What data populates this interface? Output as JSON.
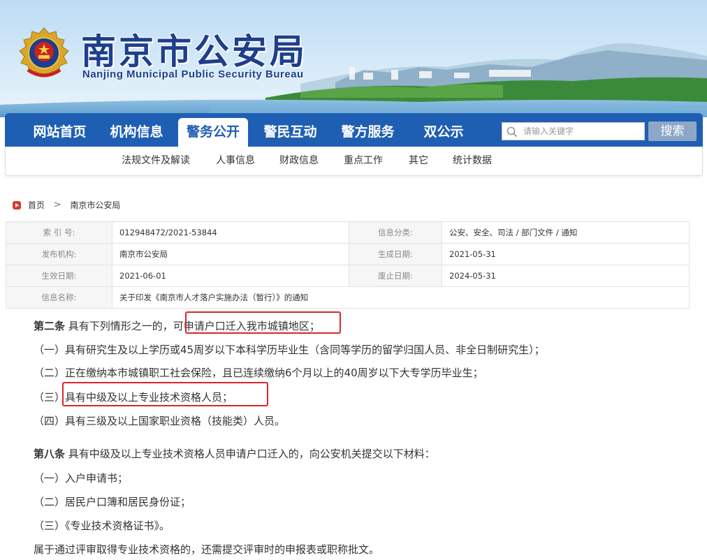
{
  "header": {
    "title": "南京市公安局",
    "subtitle": "Nanjing Municipal Public Security Bureau",
    "emblem_icon": "police-emblem-icon"
  },
  "main_nav": {
    "items": [
      {
        "label": "网站首页",
        "active": false
      },
      {
        "label": "机构信息",
        "active": false
      },
      {
        "label": "警务公开",
        "active": true
      },
      {
        "label": "警民互动",
        "active": false
      },
      {
        "label": "警方服务",
        "active": false
      },
      {
        "label": "双公示",
        "active": false
      }
    ],
    "search": {
      "placeholder": "请输入关键字",
      "value": "",
      "button_label": "搜索",
      "icon": "search-icon"
    }
  },
  "sub_nav": {
    "items": [
      "法规文件及解读",
      "人事信息",
      "财政信息",
      "重点工作",
      "其它",
      "统计数据"
    ]
  },
  "breadcrumb": {
    "home": "首页",
    "separator": ">",
    "current": "南京市公安局",
    "home_icon": "home-icon"
  },
  "info_table": {
    "rows": [
      {
        "k1": "索 引 号:",
        "v1": "012948472/2021-53844",
        "k2": "信息分类:",
        "v2": "公安、安全、司法 / 部门文件 / 通知"
      },
      {
        "k1": "发布机构:",
        "v1": "南京市公安局",
        "k2": "生成日期:",
        "v2": "2021-05-31"
      },
      {
        "k1": "生效日期:",
        "v1": "2021-06-01",
        "k2": "废止日期:",
        "v2": "2024-05-31"
      },
      {
        "k1": "信息名称:",
        "v1": "关于印发《南京市人才落户实施办法（暂行）》的通知"
      }
    ]
  },
  "article": {
    "article2": {
      "heading": "第二条",
      "text_before": " 具有下列情形之一的，",
      "highlighted": "可申请户口迁入我市城镇地区",
      "text_after": "；",
      "items": [
        "（一）具有研究生及以上学历或45周岁以下本科学历毕业生（含同等学历的留学归国人员、非全日制研究生）；",
        "（二）正在缴纳本市城镇职工社会保险，且已连续缴纳6个月以上的40周岁以下大专学历毕业生；",
        "（四）具有三级及以上国家职业资格（技能类）人员。"
      ],
      "item3_prefix": "（三）",
      "item3_highlighted": "具有中级及以上专业技术资格人员；"
    },
    "article8": {
      "heading": "第八条",
      "text": " 具有中级及以上专业技术资格人员申请户口迁入的，向公安机关提交以下材料：",
      "items": [
        "（一）入户申请书；",
        "（二）居民户口簿和居民身份证；",
        "（三）《专业技术资格证书》。"
      ],
      "note": "属于通过评审取得专业技术资格的，还需提交评审时的申报表或职称批文。"
    },
    "highlight_color": "#d9262b"
  },
  "colors": {
    "nav_blue": "#1e5fb4",
    "title_blue": "#1d3f8c",
    "search_button": "#8ea7c6"
  }
}
